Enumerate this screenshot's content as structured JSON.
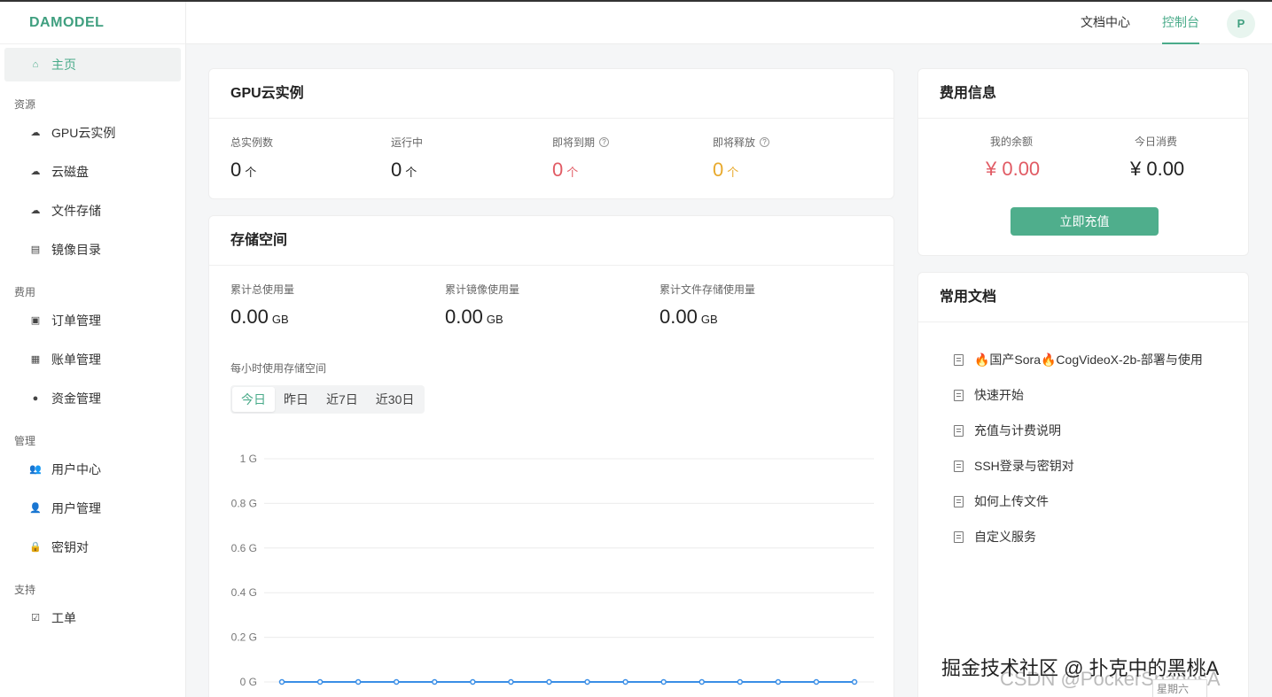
{
  "brand": "DAMODEL",
  "topnav": {
    "docs": "文档中心",
    "console": "控制台",
    "avatar": "P"
  },
  "sidebar": {
    "home": "主页",
    "groups": [
      {
        "title": "资源",
        "items": [
          "GPU云实例",
          "云磁盘",
          "文件存储",
          "镜像目录"
        ]
      },
      {
        "title": "费用",
        "items": [
          "订单管理",
          "账单管理",
          "资金管理"
        ]
      },
      {
        "title": "管理",
        "items": [
          "用户中心",
          "用户管理",
          "密钥对"
        ]
      },
      {
        "title": "支持",
        "items": [
          "工单"
        ]
      }
    ]
  },
  "gpu": {
    "title": "GPU云实例",
    "stats": [
      {
        "label": "总实例数",
        "value": "0",
        "unit": "个"
      },
      {
        "label": "运行中",
        "value": "0",
        "unit": "个"
      },
      {
        "label": "即将到期",
        "value": "0",
        "unit": "个"
      },
      {
        "label": "即将释放",
        "value": "0",
        "unit": "个"
      }
    ]
  },
  "storage": {
    "title": "存储空间",
    "stats": [
      {
        "label": "累计总使用量",
        "value": "0.00",
        "unit": "GB"
      },
      {
        "label": "累计镜像使用量",
        "value": "0.00",
        "unit": "GB"
      },
      {
        "label": "累计文件存储使用量",
        "value": "0.00",
        "unit": "GB"
      }
    ],
    "chart_label": "每小时使用存储空间",
    "ranges": [
      "今日",
      "昨日",
      "近7日",
      "近30日"
    ]
  },
  "billing": {
    "title": "费用信息",
    "balance_label": "我的余额",
    "balance_value": "¥ 0.00",
    "today_label": "今日消费",
    "today_value": "¥ 0.00",
    "recharge": "立即充值"
  },
  "docs": {
    "title": "常用文档",
    "items": [
      "🔥国产Sora🔥CogVideoX-2b-部署与使用",
      "快速开始",
      "充值与计费说明",
      "SSH登录与密钥对",
      "如何上传文件",
      "自定义服务"
    ]
  },
  "watermark": "掘金技术社区 @ 扑克中的黑桃A",
  "watermark2": "CSDN @PockerSpadesA",
  "tooltip_fragment": "星期六",
  "colors": {
    "accent": "#4aab8a",
    "danger": "#e15b64",
    "warning": "#e8a92c",
    "line": "#3a8ee6"
  },
  "chart_data": {
    "type": "line",
    "title": "",
    "xlabel": "",
    "ylabel": "",
    "ylim": [
      0,
      1
    ],
    "yticks": [
      "0 G",
      "0.2 G",
      "0.4 G",
      "0.6 G",
      "0.8 G",
      "1 G"
    ],
    "series": [
      {
        "values": [
          0,
          0,
          0,
          0,
          0,
          0,
          0,
          0,
          0,
          0,
          0,
          0,
          0,
          0,
          0,
          0
        ]
      }
    ],
    "grid": true
  }
}
